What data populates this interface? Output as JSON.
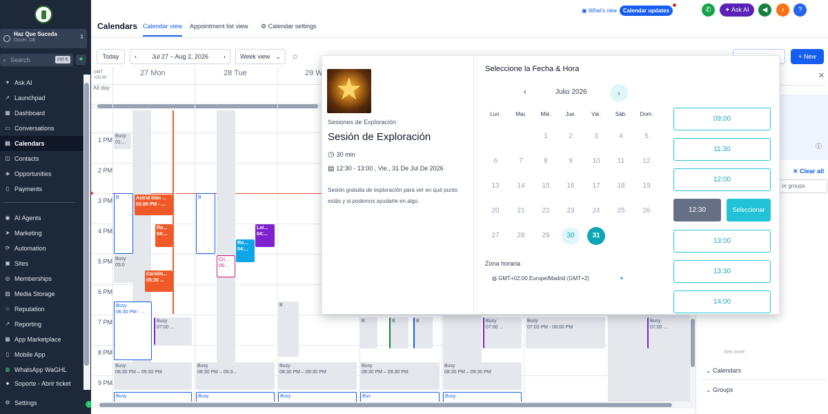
{
  "sidebar": {
    "account_name": "Haz Que Suceda",
    "account_location": "Dover, DE",
    "search_placeholder": "Search",
    "search_shortcut": "ctrl K",
    "items": [
      {
        "label": "Ask AI",
        "icon": "sparkle-icon"
      },
      {
        "label": "Launchpad",
        "icon": "rocket-icon"
      },
      {
        "label": "Dashboard",
        "icon": "dashboard-icon"
      },
      {
        "label": "Conversations",
        "icon": "chat-icon"
      },
      {
        "label": "Calendars",
        "icon": "calendar-icon"
      },
      {
        "label": "Contacts",
        "icon": "contacts-icon"
      },
      {
        "label": "Opportunities",
        "icon": "funnel-icon"
      },
      {
        "label": "Payments",
        "icon": "payments-icon"
      },
      {
        "label": "AI Agents",
        "icon": "robot-icon"
      },
      {
        "label": "Marketing",
        "icon": "send-icon"
      },
      {
        "label": "Automation",
        "icon": "automation-icon"
      },
      {
        "label": "Sites",
        "icon": "sites-icon"
      },
      {
        "label": "Memberships",
        "icon": "memberships-icon"
      },
      {
        "label": "Media Storage",
        "icon": "media-icon"
      },
      {
        "label": "Reputation",
        "icon": "star-icon"
      },
      {
        "label": "Reporting",
        "icon": "chart-icon"
      },
      {
        "label": "App Marketplace",
        "icon": "grid-icon"
      },
      {
        "label": "Mobile App",
        "icon": "mobile-icon"
      },
      {
        "label": "WhatsApp WaGHL",
        "icon": "whatsapp-icon"
      },
      {
        "label": "Soporte - Abrir ticket",
        "icon": "support-icon"
      },
      {
        "label": "Settings",
        "icon": "gear-icon"
      }
    ]
  },
  "header": {
    "title": "Calendars",
    "tabs": [
      "Calendar view",
      "Appointment list view",
      "Calendar settings"
    ],
    "whats_new": "What's new",
    "calendar_updates": "Calendar updates",
    "ask_ai": "Ask AI",
    "help": "?"
  },
  "toolbar": {
    "today": "Today",
    "date_range": "Jul 27 – Aug 2, 2026",
    "view": "Week view",
    "new_label": "New"
  },
  "calendar": {
    "timezone_label": "GMT +02:00",
    "days": [
      "27 Mon",
      "28 Tue",
      "29 W"
    ],
    "all_day": "All day",
    "hours": [
      "1 PM",
      "2 PM",
      "3 PM",
      "4 PM",
      "5 PM",
      "6 PM",
      "7 PM",
      "8 PM",
      "9 PM"
    ],
    "events": {
      "busy": "Busy",
      "e1": "01:...",
      "astrid": "Astrid Illán ...",
      "astrid_time": "03:00 PM - ...",
      "ro": "Ro...",
      "ro_time": "04:...",
      "lo": "Loi...",
      "lo_time": "04:...",
      "ro2": "Ro...",
      "ro2_time": "04:...",
      "carolina": "Carolin...",
      "carolina_time": "05:30 ...",
      "cri": "Cri...",
      "cri_time": "05:...",
      "busy_0530": "05:0",
      "busy_0630": "06:30 PM - ...",
      "busy_0700": "07:00 ...",
      "busy_0700_b": "07:00 PM - 08:00 PM",
      "busy_0830": "08:30 PM – 09:30 PM",
      "busy_0830_short": "08:30 PM – 09:3...",
      "bus": "Bus",
      "b_short": "B"
    }
  },
  "right_panel": {
    "clear_all": "Clear all",
    "search_placeholder": "or groups",
    "calendars": "Calendars",
    "groups": "Groups",
    "see_more": "See more"
  },
  "booking": {
    "group": "Sesiones de Exploración",
    "title": "Sesión de Exploración",
    "duration": "30 min",
    "datetime": "12:30 - 13:00 , Vie., 31 De Jul De 2026",
    "description": "Sesión gratuita de exploración para ver en qué punto estás y si podemos ayudarte en algo.",
    "picker_title": "Seleccione la Fecha & Hora",
    "month": "Julio 2026",
    "weekdays": [
      "Lun.",
      "Mar.",
      "Mié.",
      "Jue.",
      "Vie.",
      "Sáb.",
      "Dom."
    ],
    "weeks": [
      [
        "",
        "",
        "1",
        "2",
        "3",
        "4",
        "5"
      ],
      [
        "6",
        "7",
        "8",
        "9",
        "10",
        "11",
        "12"
      ],
      [
        "13",
        "14",
        "15",
        "16",
        "17",
        "18",
        "19"
      ],
      [
        "20",
        "21",
        "22",
        "23",
        "24",
        "25",
        "26"
      ],
      [
        "27",
        "28",
        "29",
        "30",
        "31",
        "",
        ""
      ]
    ],
    "tz_label": "Zona horaria",
    "tz_value": "GMT+02:00 Europe/Madrid (GMT+2)",
    "slots": [
      "09:00",
      "11:30",
      "12:00",
      "12:30",
      "13:00",
      "13:30",
      "14:00"
    ],
    "selected_slot": "12:30",
    "select_button": "Seleccionar"
  },
  "colors": {
    "brand_blue": "#155eef",
    "teal": "#0ea5b7",
    "sidebar": "#1d2939"
  }
}
